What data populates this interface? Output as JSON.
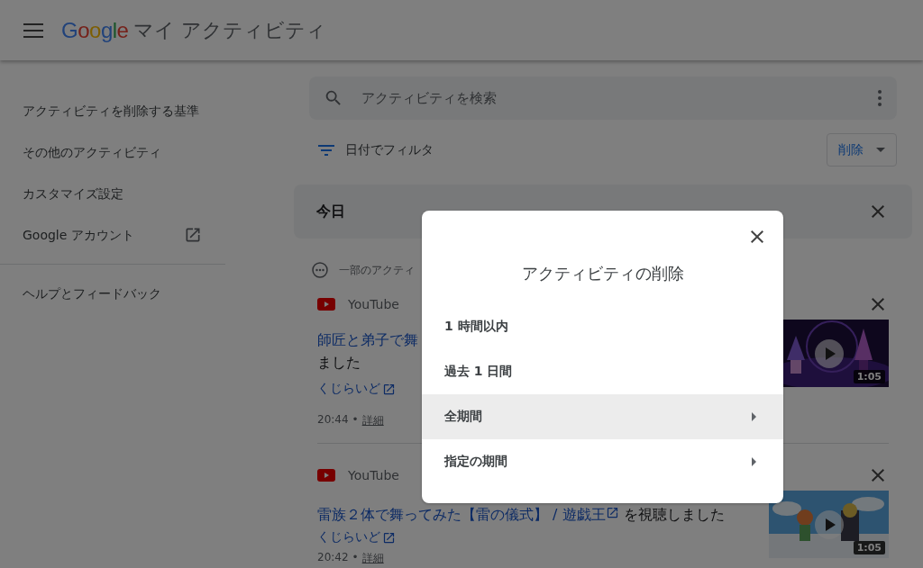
{
  "header": {
    "logo": "Google",
    "title": "マイ アクティビティ"
  },
  "sidebar": {
    "items": [
      {
        "label": "アクティビティを削除する基準",
        "external": false
      },
      {
        "label": "その他のアクティビティ",
        "external": false
      },
      {
        "label": "カスタマイズ設定",
        "external": false
      },
      {
        "label": "Google アカウント",
        "external": true
      }
    ],
    "footer_items": [
      {
        "label": "ヘルプとフィードバック",
        "external": false
      }
    ]
  },
  "search": {
    "placeholder": "アクティビティを検索"
  },
  "filter": {
    "label": "日付でフィルタ"
  },
  "delete_button": {
    "label": "削除"
  },
  "day": {
    "label": "今日"
  },
  "notice": {
    "text": "一部のアクティ"
  },
  "activities": [
    {
      "service": "YouTube",
      "lines": [
        [
          {
            "text": "師匠と弟子で舞",
            "link": true,
            "external": false
          }
        ],
        [
          {
            "text": "ました",
            "link": false
          }
        ]
      ],
      "channel": "くじらいど",
      "time": "20:44",
      "separator": "•",
      "details": "詳細",
      "duration": "1:05"
    },
    {
      "service": "YouTube",
      "lines": [
        [
          {
            "text": "雷族２体で舞ってみた【雷の儀式】 / 遊戯王",
            "link": true,
            "external": true
          },
          {
            "text": " を視聴しました",
            "link": false
          }
        ]
      ],
      "channel": "くじらいど",
      "time": "20:42",
      "separator": "•",
      "details": "詳細",
      "duration": "1:05"
    }
  ],
  "dialog": {
    "title": "アクティビティの削除",
    "options": [
      {
        "label": "1 時間以内",
        "selected": false,
        "submenu": false
      },
      {
        "label": "過去 1 日間",
        "selected": false,
        "submenu": false
      },
      {
        "label": "全期間",
        "selected": true,
        "submenu": true
      },
      {
        "label": "指定の期間",
        "selected": false,
        "submenu": true
      }
    ]
  }
}
